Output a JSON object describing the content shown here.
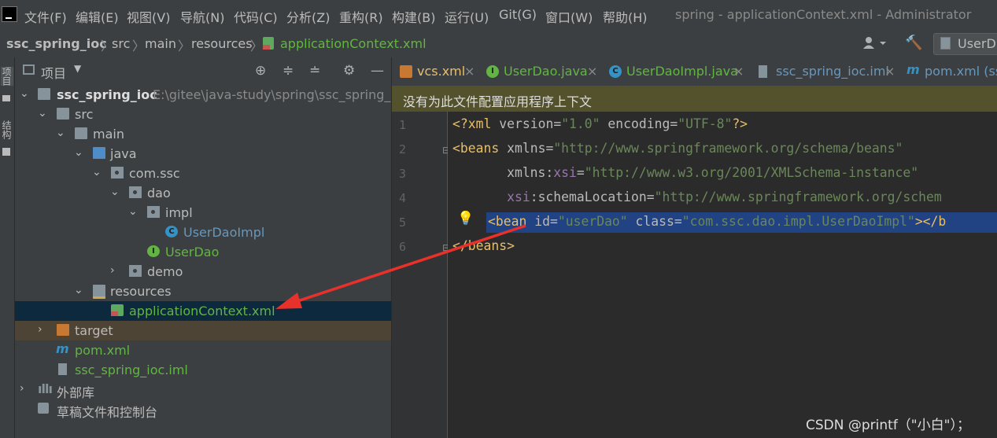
{
  "menubar": {
    "items": [
      "文件(F)",
      "编辑(E)",
      "视图(V)",
      "导航(N)",
      "代码(C)",
      "分析(Z)",
      "重构(R)",
      "构建(B)",
      "运行(U)",
      "Git(G)",
      "窗口(W)",
      "帮助(H)"
    ],
    "window_title": "spring - applicationContext.xml - Administrator"
  },
  "navbar": {
    "crumbs": [
      "ssc_spring_ioc",
      "src",
      "main",
      "resources",
      "applicationContext.xml"
    ],
    "run_config": "UserD"
  },
  "stripe": {
    "project_tab": "项目",
    "structure_tab": "结构"
  },
  "project_panel": {
    "title": "项目",
    "rows": [
      {
        "label": "ssc_spring_ioc",
        "path": "E:\\gitee\\java-study\\spring\\ssc_spring_ioc"
      },
      {
        "label": "src"
      },
      {
        "label": "main"
      },
      {
        "label": "java"
      },
      {
        "label": "com.ssc"
      },
      {
        "label": "dao"
      },
      {
        "label": "impl"
      },
      {
        "label": "UserDaoImpl"
      },
      {
        "label": "UserDao"
      },
      {
        "label": "demo"
      },
      {
        "label": "resources"
      },
      {
        "label": "applicationContext.xml"
      },
      {
        "label": "target"
      },
      {
        "label": "pom.xml"
      },
      {
        "label": "ssc_spring_ioc.iml"
      },
      {
        "label": "外部库"
      },
      {
        "label": "草稿文件和控制台"
      }
    ]
  },
  "editor": {
    "tabs": [
      "vcs.xml",
      "UserDao.java",
      "UserDaoImpl.java",
      "ssc_spring_ioc.iml",
      "pom.xml (ss"
    ],
    "notice": "没有为此文件配置应用程序上下文",
    "line_numbers": [
      "1",
      "2",
      "3",
      "4",
      "5",
      "6"
    ],
    "code": {
      "l1": {
        "open": "<?",
        "tag": "xml",
        "a1": "version",
        "v1": "\"1.0\"",
        "a2": "encoding",
        "v2": "\"UTF-8\"",
        "close": "?>"
      },
      "l2": {
        "open": "<",
        "tag": "beans",
        "a1": "xmlns",
        "v1": "\"http://www.springframework.org/schema/beans\""
      },
      "l3": {
        "ns": "xmlns",
        "colon": ":",
        "a1": "xsi",
        "v1": "\"http://www.w3.org/2001/XMLSchema-instance\""
      },
      "l4": {
        "ns": "xsi",
        "colon": ":",
        "a1": "schemaLocation",
        "v1": "\"http://www.springframework.org/schem"
      },
      "l5": {
        "open": "<",
        "tag": "bean",
        "a1": "id",
        "v1": "\"userDao\"",
        "a2": "class",
        "v2": "\"com.ssc.dao.impl.UserDaoImpl\"",
        "close": "></b"
      },
      "l6": {
        "open": "</",
        "tag": "beans",
        "close": ">"
      }
    }
  },
  "watermark": "CSDN @printf（\"小白\"）；",
  "colors": {
    "accent_arrow": "#e8312a",
    "selection": "#214283",
    "notice": "#54522d"
  }
}
